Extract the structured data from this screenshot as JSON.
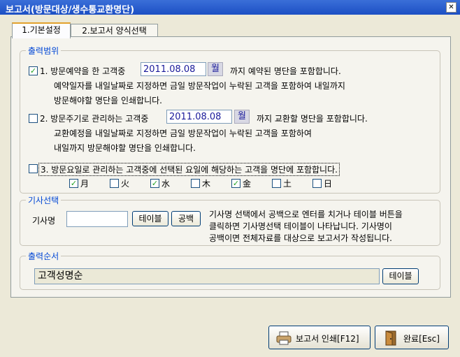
{
  "window": {
    "title": "보고서(방문대상/생수통교환명단)",
    "close_label": "✕"
  },
  "tabs": [
    {
      "label": "1.기본설정",
      "active": true
    },
    {
      "label": "2.보고서 양식선택",
      "active": false
    }
  ],
  "output_range": {
    "group_label": "출력범위",
    "option1": {
      "checked": true,
      "label_prefix": "1. 방문예약을 한 고객중",
      "date": "2011.08.08",
      "date_button": "월",
      "label_suffix": "까지 예약된 명단을 포함합니다.",
      "desc_line1": "예약일자를 내일날짜로 지정하면 금일 방문작업이 누락된 고객을 포함하여 내일까지",
      "desc_line2": "방문해야할 명단을 인쇄합니다."
    },
    "option2": {
      "checked": false,
      "label_prefix": "2. 방문주기로 관리하는 고객중",
      "date": "2011.08.08",
      "date_button": "월",
      "label_suffix": "까지 교환할 명단을 포함합니다.",
      "desc_line1": "교환예정을 내일날짜로 지정하면 금일 방문작업이 누락된 고객을 포함하여",
      "desc_line2": "내일까지 방문해야할 명단을 인쇄합니다."
    },
    "option3": {
      "checked": false,
      "label": "3. 방문요일로 관리하는 고객중에  선택된 요일에 해당하는 고객을 명단에 포함합니다."
    },
    "weekdays": [
      {
        "label": "月",
        "checked": true
      },
      {
        "label": "火",
        "checked": false
      },
      {
        "label": "水",
        "checked": true
      },
      {
        "label": "木",
        "checked": false
      },
      {
        "label": "金",
        "checked": true
      },
      {
        "label": "土",
        "checked": false
      },
      {
        "label": "日",
        "checked": false
      }
    ]
  },
  "driver_select": {
    "group_label": "기사선택",
    "field_label": "기사명",
    "field_value": "",
    "table_button": "테이블",
    "blank_button": "공백",
    "help_line1": "기사명 선택에서 공백으로 엔터를 치거나 테이블 버튼을",
    "help_line2": "클릭하면 기사명선택 테이블이 나타납니다. 기사명이",
    "help_line3": "공백이면 전체자료를 대상으로 보고서가 작성됩니다."
  },
  "output_order": {
    "group_label": "출력순서",
    "value": "고객성명순",
    "table_button": "테이블"
  },
  "footer": {
    "print_button": "보고서 인쇄[F12]",
    "close_button": "완료[Esc]"
  },
  "colors": {
    "title_bar": "#1c4fc4",
    "group_label": "#0046d5",
    "accent_tab": "#e2a12c",
    "check": "#21a121"
  }
}
